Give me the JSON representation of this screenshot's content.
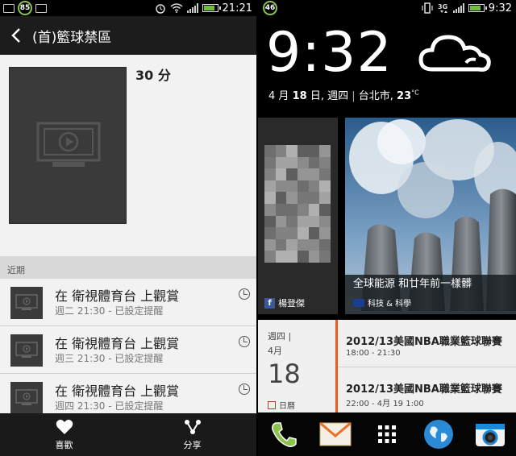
{
  "left": {
    "status": {
      "badge": "85",
      "time": "21:21"
    },
    "header": {
      "title": "(首)籃球禁區"
    },
    "detail": {
      "duration": "30 分"
    },
    "section": {
      "title": "近期"
    },
    "items": [
      {
        "title": "在 衛視體育台 上觀賞",
        "subtitle": "週二 21:30 - 已設定提醒"
      },
      {
        "title": "在 衛視體育台 上觀賞",
        "subtitle": "週三 21:30 - 已設定提醒"
      },
      {
        "title": "在 衛視體育台 上觀賞",
        "subtitle": "週四 21:30 - 已設定提醒"
      }
    ],
    "bottom": {
      "like_label": "喜歡",
      "share_label": "分享"
    }
  },
  "right": {
    "status": {
      "badge": "46",
      "time": "9:32"
    },
    "clock": {
      "time": "9:32"
    },
    "date": {
      "month": "4",
      "month_unit": "月",
      "day": "18",
      "day_unit": "日",
      "weekday": ", 週四",
      "city": "台北市,",
      "temp": "23",
      "temp_unit": "°C"
    },
    "tiles": {
      "person_name": "楊登傑",
      "news_title": "全球能源 和廿年前一樣髒",
      "news_source": "科技 & 科學"
    },
    "calendar": {
      "weekday": "週四 |",
      "month": "4月",
      "day": "18",
      "label": "日曆",
      "events": [
        {
          "title": "2012/13美國NBA職業籃球聯賽",
          "time": "18:00 - 21:30"
        },
        {
          "title": "2012/13美國NBA職業籃球聯賽",
          "time": "22:00 - 4月 19 1:00"
        }
      ]
    }
  },
  "colors": {
    "accent_orange": "#e85a1e",
    "facebook_blue": "#3b5998",
    "battery_green": "#6fbf3a"
  }
}
